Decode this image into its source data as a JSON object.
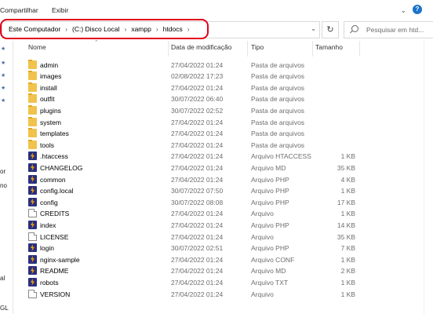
{
  "ribbon": {
    "tabs": [
      "Compartilhar",
      "Exibir"
    ]
  },
  "address": {
    "crumbs": [
      "Este Computador",
      "(C:) Disco Local",
      "xampp",
      "htdocs"
    ]
  },
  "search": {
    "placeholder": "Pesquisar em htd..."
  },
  "left_pane": {
    "labels": [
      "or",
      "no",
      "al",
      "GL"
    ]
  },
  "columns": {
    "name": "Nome",
    "date": "Data de modificação",
    "type": "Tipo",
    "size": "Tamanho"
  },
  "files": [
    {
      "name": "admin",
      "date": "27/04/2022 01:24",
      "type": "Pasta de arquivos",
      "size": "",
      "icon": "folder-icon"
    },
    {
      "name": "images",
      "date": "02/08/2022 17:23",
      "type": "Pasta de arquivos",
      "size": "",
      "icon": "folder-icon"
    },
    {
      "name": "install",
      "date": "27/04/2022 01:24",
      "type": "Pasta de arquivos",
      "size": "",
      "icon": "folder-icon"
    },
    {
      "name": "outfit",
      "date": "30/07/2022 06:40",
      "type": "Pasta de arquivos",
      "size": "",
      "icon": "folder-icon"
    },
    {
      "name": "plugins",
      "date": "30/07/2022 02:52",
      "type": "Pasta de arquivos",
      "size": "",
      "icon": "folder-icon"
    },
    {
      "name": "system",
      "date": "27/04/2022 01:24",
      "type": "Pasta de arquivos",
      "size": "",
      "icon": "folder-icon"
    },
    {
      "name": "templates",
      "date": "27/04/2022 01:24",
      "type": "Pasta de arquivos",
      "size": "",
      "icon": "folder-icon"
    },
    {
      "name": "tools",
      "date": "27/04/2022 01:24",
      "type": "Pasta de arquivos",
      "size": "",
      "icon": "folder-icon"
    },
    {
      "name": ".htaccess",
      "date": "27/04/2022 01:24",
      "type": "Arquivo HTACCESS",
      "size": "1 KB",
      "icon": "xampp-file-icon"
    },
    {
      "name": "CHANGELOG",
      "date": "27/04/2022 01:24",
      "type": "Arquivo MD",
      "size": "35 KB",
      "icon": "xampp-file-icon"
    },
    {
      "name": "common",
      "date": "27/04/2022 01:24",
      "type": "Arquivo PHP",
      "size": "4 KB",
      "icon": "xampp-file-icon"
    },
    {
      "name": "config.local",
      "date": "30/07/2022 07:50",
      "type": "Arquivo PHP",
      "size": "1 KB",
      "icon": "xampp-file-icon"
    },
    {
      "name": "config",
      "date": "30/07/2022 08:08",
      "type": "Arquivo PHP",
      "size": "17 KB",
      "icon": "xampp-file-icon"
    },
    {
      "name": "CREDITS",
      "date": "27/04/2022 01:24",
      "type": "Arquivo",
      "size": "1 KB",
      "icon": "blank-file-icon"
    },
    {
      "name": "index",
      "date": "27/04/2022 01:24",
      "type": "Arquivo PHP",
      "size": "14 KB",
      "icon": "xampp-file-icon"
    },
    {
      "name": "LICENSE",
      "date": "27/04/2022 01:24",
      "type": "Arquivo",
      "size": "35 KB",
      "icon": "blank-file-icon"
    },
    {
      "name": "login",
      "date": "30/07/2022 02:51",
      "type": "Arquivo PHP",
      "size": "7 KB",
      "icon": "xampp-file-icon"
    },
    {
      "name": "nginx-sample",
      "date": "27/04/2022 01:24",
      "type": "Arquivo CONF",
      "size": "1 KB",
      "icon": "xampp-file-icon"
    },
    {
      "name": "README",
      "date": "27/04/2022 01:24",
      "type": "Arquivo MD",
      "size": "2 KB",
      "icon": "xampp-file-icon"
    },
    {
      "name": "robots",
      "date": "27/04/2022 01:24",
      "type": "Arquivo TXT",
      "size": "1 KB",
      "icon": "xampp-file-icon"
    },
    {
      "name": "VERSION",
      "date": "27/04/2022 01:24",
      "type": "Arquivo",
      "size": "1 KB",
      "icon": "blank-file-icon"
    }
  ]
}
